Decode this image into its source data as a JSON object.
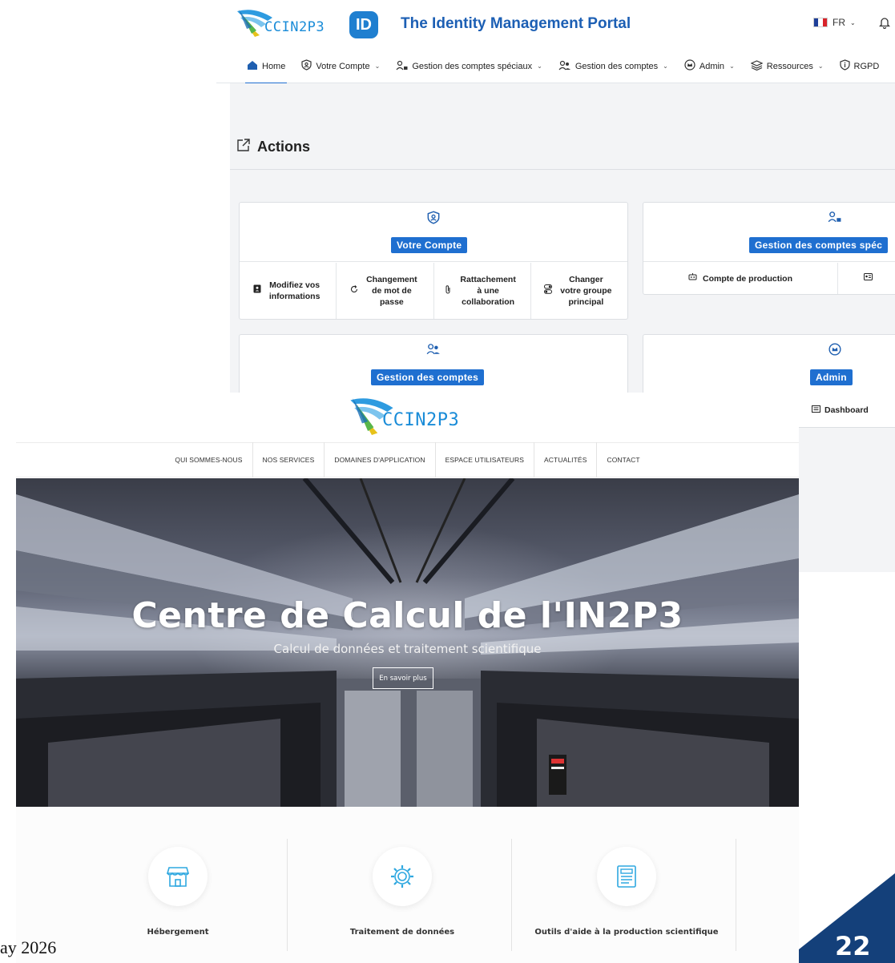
{
  "portal": {
    "logo_text": "CCIN2P3",
    "id_badge": "ID",
    "title": "The Identity Management Portal",
    "language": "FR",
    "nav": [
      {
        "label": "Home",
        "icon": "home-icon"
      },
      {
        "label": "Votre Compte",
        "icon": "user-shield-icon"
      },
      {
        "label": "Gestion des comptes spéciaux",
        "icon": "user-lock-icon"
      },
      {
        "label": "Gestion des comptes",
        "icon": "users-icon"
      },
      {
        "label": "Admin",
        "icon": "crown-shield-icon"
      },
      {
        "label": "Ressources",
        "icon": "layers-icon"
      },
      {
        "label": "RGPD",
        "icon": "info-shield-icon"
      }
    ],
    "section_title": "Actions",
    "cards": {
      "votre_compte": {
        "pill": "Votre Compte",
        "actions": [
          "Modifiez vos informations",
          "Changement de mot de passe",
          "Rattachement à une collaboration",
          "Changer votre groupe principal"
        ]
      },
      "speciaux": {
        "pill": "Gestion des comptes spéc",
        "actions": [
          "Compte de production"
        ]
      },
      "gestion": {
        "pill": "Gestion des comptes"
      },
      "admin": {
        "pill": "Admin",
        "actions": [
          "Dashboard"
        ]
      }
    }
  },
  "site": {
    "logo_text": "CCIN2P3",
    "nav": [
      "QUI SOMMES-NOUS",
      "NOS SERVICES",
      "DOMAINES D'APPLICATION",
      "ESPACE UTILISATEURS",
      "ACTUALITÉS",
      "CONTACT"
    ],
    "hero_title": "Centre de Calcul de l'IN2P3",
    "hero_subtitle": "Calcul de données et traitement scientifique",
    "hero_button": "En savoir plus",
    "features": [
      "Hébergement",
      "Traitement de données",
      "Outils d'aide à la production scientifique"
    ]
  },
  "slide": {
    "date_fragment": "ay 2026",
    "page_number": "22"
  },
  "colors": {
    "accent_blue": "#1f6fd0",
    "title_blue": "#1c5fb4",
    "logo_cyan": "#1a8cd8",
    "feature_icon": "#2fa8e0",
    "page_corner": "#14407a"
  }
}
